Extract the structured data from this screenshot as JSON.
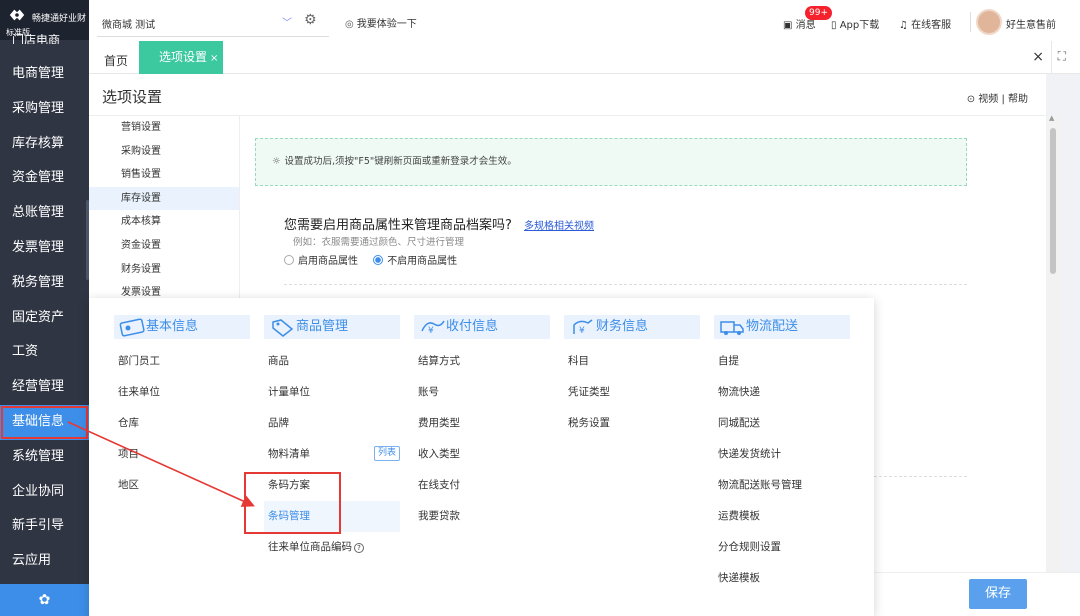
{
  "app": {
    "logo_name": "畅捷通好业财",
    "edition": "标准版",
    "nav_cut": "门店电商"
  },
  "sidebar": {
    "items": [
      {
        "label": "电商管理"
      },
      {
        "label": "采购管理"
      },
      {
        "label": "库存核算"
      },
      {
        "label": "资金管理"
      },
      {
        "label": "总账管理"
      },
      {
        "label": "发票管理"
      },
      {
        "label": "税务管理"
      },
      {
        "label": "固定资产"
      },
      {
        "label": "工资"
      },
      {
        "label": "经营管理"
      },
      {
        "label": "基础信息",
        "active": true
      },
      {
        "label": "系统管理"
      },
      {
        "label": "企业协同"
      },
      {
        "label": "新手引导"
      },
      {
        "label": "云应用"
      }
    ]
  },
  "topbar": {
    "store": "微商城 测试",
    "try": "我要体验一下",
    "message": "消息",
    "message_badge": "99+",
    "app_download": "App下载",
    "service": "在线客服",
    "user": "好生意售前"
  },
  "tabs": {
    "home": "首页",
    "active": "选项设置",
    "active_close": "×"
  },
  "page": {
    "title": "选项设置",
    "links": "视频 | 帮助"
  },
  "subnav": {
    "items": [
      {
        "label": "营销设置"
      },
      {
        "label": "采购设置"
      },
      {
        "label": "销售设置"
      },
      {
        "label": "库存设置",
        "active": true
      },
      {
        "label": "成本核算"
      },
      {
        "label": "资金设置"
      },
      {
        "label": "财务设置"
      },
      {
        "label": "发票设置"
      }
    ]
  },
  "settings": {
    "notice": "设置成功后,须按\"F5\"键刷新页面或重新登录才会生效。",
    "question": "您需要启用商品属性来管理商品档案吗?",
    "question_link": "多规格相关视频",
    "example": "例如：衣服需要通过颜色、尺寸进行管理",
    "options": [
      {
        "label": "启用商品属性",
        "checked": false
      },
      {
        "label": "不启用商品属性",
        "checked": true
      }
    ],
    "save": "保存"
  },
  "mega_menu": {
    "columns": [
      {
        "title": "基本信息",
        "icon": "id-card-icon",
        "items": [
          "部门员工",
          "往来单位",
          "仓库",
          "项目",
          "地区"
        ]
      },
      {
        "title": "商品管理",
        "icon": "tag-icon",
        "items": [
          "商品",
          "计量单位",
          "品牌",
          "物料清单",
          "条码方案",
          "条码管理",
          "往来单位商品编码"
        ],
        "item_tag": "列表"
      },
      {
        "title": "收付信息",
        "icon": "money-icon",
        "items": [
          "结算方式",
          "账号",
          "费用类型",
          "收入类型",
          "在线支付",
          "我要贷款"
        ]
      },
      {
        "title": "财务信息",
        "icon": "finance-icon",
        "items": [
          "科目",
          "凭证类型",
          "税务设置"
        ]
      },
      {
        "title": "物流配送",
        "icon": "truck-icon",
        "items": [
          "自提",
          "物流快递",
          "同城配送",
          "快递发货统计",
          "物流配送账号管理",
          "运费模板",
          "分仓规则设置",
          "快递模板"
        ]
      }
    ]
  },
  "colors": {
    "sidebar_bg": "#2f3542",
    "accent": "#3d8ee8",
    "tab_green": "#3dc9a0",
    "highlight_red": "#e53935"
  }
}
